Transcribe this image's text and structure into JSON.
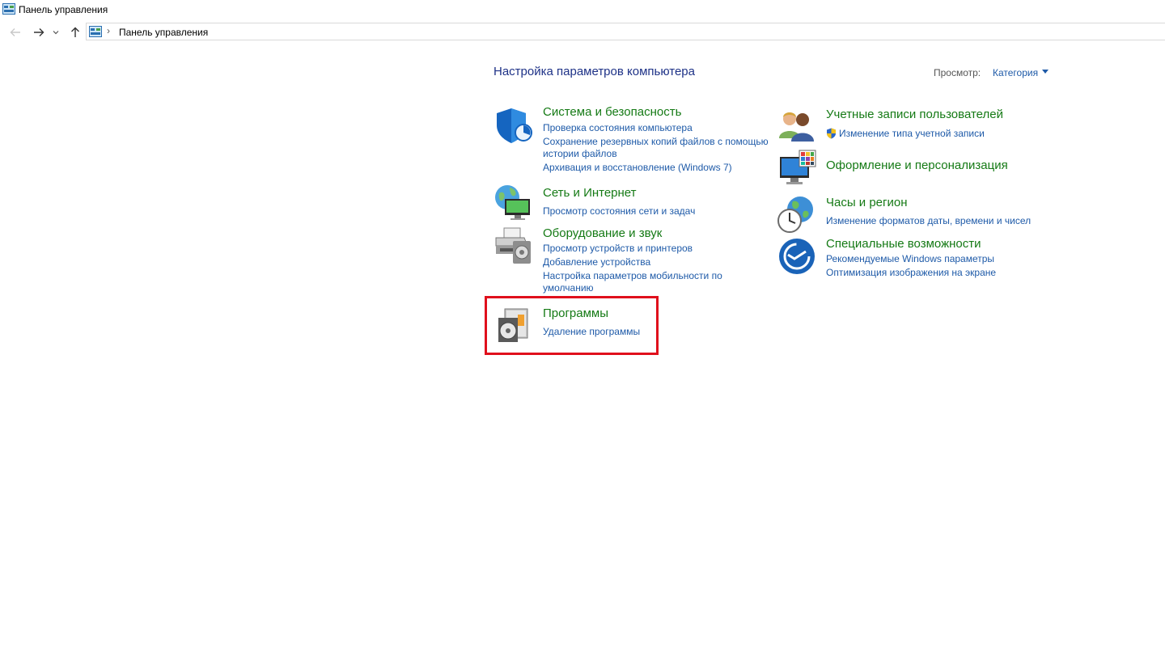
{
  "window": {
    "title": "Панель управления"
  },
  "navigation": {
    "breadcrumb_separator": "›",
    "breadcrumb": "Панель управления"
  },
  "main": {
    "heading": "Настройка параметров компьютера",
    "view_label": "Просмотр:",
    "view_value": "Категория"
  },
  "categories": {
    "system": {
      "title": "Система и безопасность",
      "links": [
        "Проверка состояния компьютера",
        "Сохранение резервных копий файлов с помощью",
        "истории файлов",
        "Архивация и восстановление (Windows 7)"
      ]
    },
    "network": {
      "title": "Сеть и Интернет",
      "links": [
        "Просмотр состояния сети и задач"
      ]
    },
    "hardware": {
      "title": "Оборудование и звук",
      "links": [
        "Просмотр устройств и принтеров",
        "Добавление устройства",
        "Настройка параметров мобильности по",
        "умолчанию"
      ]
    },
    "programs": {
      "title": "Программы",
      "links": [
        "Удаление программы"
      ]
    },
    "accounts": {
      "title": "Учетные записи пользователей",
      "links": [
        "Изменение типа учетной записи"
      ]
    },
    "appearance": {
      "title": "Оформление и персонализация",
      "links": []
    },
    "clock": {
      "title": "Часы и регион",
      "links": [
        "Изменение форматов даты, времени и чисел"
      ]
    },
    "accessibility": {
      "title": "Специальные возможности",
      "links": [
        "Рекомендуемые Windows параметры",
        "Оптимизация изображения на экране"
      ]
    }
  },
  "colors": {
    "category_title": "#157a15",
    "link": "#1e5aa8",
    "heading": "#1e3287",
    "highlight": "#e0101c"
  },
  "icons": {
    "nav": [
      "arrow-left-icon",
      "arrow-right-icon",
      "chevron-down-icon",
      "arrow-up-icon"
    ],
    "categories": [
      "shield-icon",
      "network-globe-icon",
      "printer-icon",
      "programs-disc-icon",
      "users-icon",
      "monitor-palette-icon",
      "clock-globe-icon",
      "accessibility-icon"
    ]
  }
}
